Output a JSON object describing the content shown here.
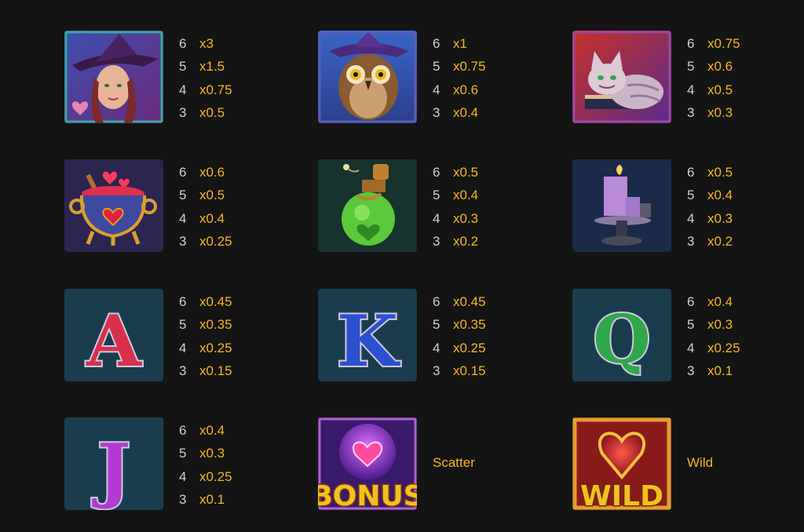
{
  "colors": {
    "background": "#141414",
    "count": "#cfcfcf",
    "multiplier": "#f2b81c"
  },
  "symbols": [
    {
      "name": "witch",
      "icon": "witch-icon",
      "pays": [
        {
          "count": "6",
          "mult": "x3"
        },
        {
          "count": "5",
          "mult": "x1.5"
        },
        {
          "count": "4",
          "mult": "x0.75"
        },
        {
          "count": "3",
          "mult": "x0.5"
        }
      ]
    },
    {
      "name": "owl",
      "icon": "owl-icon",
      "pays": [
        {
          "count": "6",
          "mult": "x1"
        },
        {
          "count": "5",
          "mult": "x0.75"
        },
        {
          "count": "4",
          "mult": "x0.6"
        },
        {
          "count": "3",
          "mult": "x0.4"
        }
      ]
    },
    {
      "name": "cat",
      "icon": "cat-icon",
      "pays": [
        {
          "count": "6",
          "mult": "x0.75"
        },
        {
          "count": "5",
          "mult": "x0.6"
        },
        {
          "count": "4",
          "mult": "x0.5"
        },
        {
          "count": "3",
          "mult": "x0.3"
        }
      ]
    },
    {
      "name": "cauldron",
      "icon": "cauldron-icon",
      "pays": [
        {
          "count": "6",
          "mult": "x0.6"
        },
        {
          "count": "5",
          "mult": "x0.5"
        },
        {
          "count": "4",
          "mult": "x0.4"
        },
        {
          "count": "3",
          "mult": "x0.25"
        }
      ]
    },
    {
      "name": "potion",
      "icon": "potion-icon",
      "pays": [
        {
          "count": "6",
          "mult": "x0.5"
        },
        {
          "count": "5",
          "mult": "x0.4"
        },
        {
          "count": "4",
          "mult": "x0.3"
        },
        {
          "count": "3",
          "mult": "x0.2"
        }
      ]
    },
    {
      "name": "candle",
      "icon": "candle-icon",
      "pays": [
        {
          "count": "6",
          "mult": "x0.5"
        },
        {
          "count": "5",
          "mult": "x0.4"
        },
        {
          "count": "4",
          "mult": "x0.3"
        },
        {
          "count": "3",
          "mult": "x0.2"
        }
      ]
    },
    {
      "name": "ace",
      "icon": "letter-a-icon",
      "glyph": "A",
      "pays": [
        {
          "count": "6",
          "mult": "x0.45"
        },
        {
          "count": "5",
          "mult": "x0.35"
        },
        {
          "count": "4",
          "mult": "x0.25"
        },
        {
          "count": "3",
          "mult": "x0.15"
        }
      ]
    },
    {
      "name": "king",
      "icon": "letter-k-icon",
      "glyph": "K",
      "pays": [
        {
          "count": "6",
          "mult": "x0.45"
        },
        {
          "count": "5",
          "mult": "x0.35"
        },
        {
          "count": "4",
          "mult": "x0.25"
        },
        {
          "count": "3",
          "mult": "x0.15"
        }
      ]
    },
    {
      "name": "queen",
      "icon": "letter-q-icon",
      "glyph": "Q",
      "pays": [
        {
          "count": "6",
          "mult": "x0.4"
        },
        {
          "count": "5",
          "mult": "x0.3"
        },
        {
          "count": "4",
          "mult": "x0.25"
        },
        {
          "count": "3",
          "mult": "x0.1"
        }
      ]
    },
    {
      "name": "jack",
      "icon": "letter-j-icon",
      "glyph": "J",
      "pays": [
        {
          "count": "6",
          "mult": "x0.4"
        },
        {
          "count": "5",
          "mult": "x0.3"
        },
        {
          "count": "4",
          "mult": "x0.25"
        },
        {
          "count": "3",
          "mult": "x0.1"
        }
      ]
    }
  ],
  "specials": [
    {
      "name": "scatter",
      "icon": "bonus-heart-icon",
      "logo_text": "BONUS",
      "label": "Scatter"
    },
    {
      "name": "wild",
      "icon": "wild-heart-icon",
      "logo_text": "WILD",
      "label": "Wild"
    }
  ]
}
